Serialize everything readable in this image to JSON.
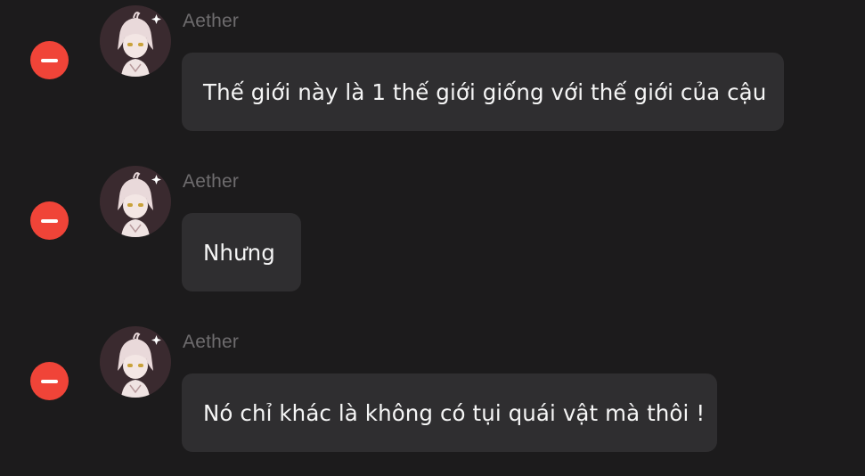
{
  "colors": {
    "background": "#1c1b1c",
    "bubble": "#2f2e30",
    "remove_button": "#f04438",
    "author_text": "#6e6c6e",
    "message_text": "#f5f5f5"
  },
  "messages": [
    {
      "author": "Aether",
      "text": "Thế giới này là 1 thế giới giống với thế giới của cậu",
      "remove_icon": "minus-circle-icon",
      "avatar": "character-avatar"
    },
    {
      "author": "Aether",
      "text": "Nhưng",
      "remove_icon": "minus-circle-icon",
      "avatar": "character-avatar"
    },
    {
      "author": "Aether",
      "text": "Nó chỉ khác là không có tụi quái vật mà thôi !",
      "remove_icon": "minus-circle-icon",
      "avatar": "character-avatar"
    }
  ]
}
